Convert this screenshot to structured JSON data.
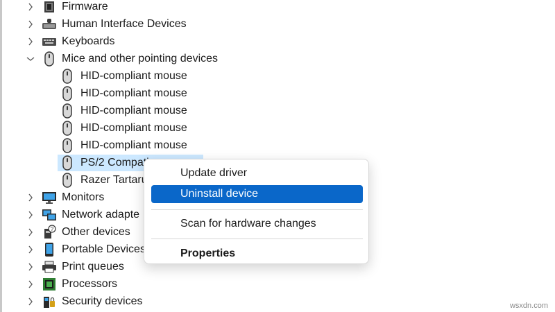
{
  "tree": {
    "items": [
      {
        "label": "Firmware",
        "expanded": false,
        "icon": "firmware-icon"
      },
      {
        "label": "Human Interface Devices",
        "expanded": false,
        "icon": "hid-icon"
      },
      {
        "label": "Keyboards",
        "expanded": false,
        "icon": "keyboard-icon"
      },
      {
        "label": "Mice and other pointing devices",
        "expanded": true,
        "icon": "mouse-icon"
      },
      {
        "label": "HID-compliant mouse",
        "icon": "mouse-icon"
      },
      {
        "label": "HID-compliant mouse",
        "icon": "mouse-icon"
      },
      {
        "label": "HID-compliant mouse",
        "icon": "mouse-icon"
      },
      {
        "label": "HID-compliant mouse",
        "icon": "mouse-icon"
      },
      {
        "label": "HID-compliant mouse",
        "icon": "mouse-icon"
      },
      {
        "label": "PS/2 Compati",
        "icon": "mouse-icon",
        "selected": true
      },
      {
        "label": "Razer Tartaru",
        "icon": "mouse-icon"
      },
      {
        "label": "Monitors",
        "expanded": false,
        "icon": "monitor-icon"
      },
      {
        "label": "Network adapte",
        "expanded": false,
        "icon": "network-icon"
      },
      {
        "label": "Other devices",
        "expanded": false,
        "icon": "other-devices-icon"
      },
      {
        "label": "Portable Devices",
        "expanded": false,
        "icon": "portable-device-icon"
      },
      {
        "label": "Print queues",
        "expanded": false,
        "icon": "printer-icon"
      },
      {
        "label": "Processors",
        "expanded": false,
        "icon": "processor-icon"
      },
      {
        "label": "Security devices",
        "expanded": false,
        "icon": "security-device-icon"
      }
    ]
  },
  "context_menu": {
    "update_driver": "Update driver",
    "uninstall_device": "Uninstall device",
    "scan_hardware": "Scan for hardware changes",
    "properties": "Properties"
  },
  "watermark": "wsxdn.com",
  "colors": {
    "menu_highlight": "#0a67c9",
    "selection": "#cce8ff"
  }
}
